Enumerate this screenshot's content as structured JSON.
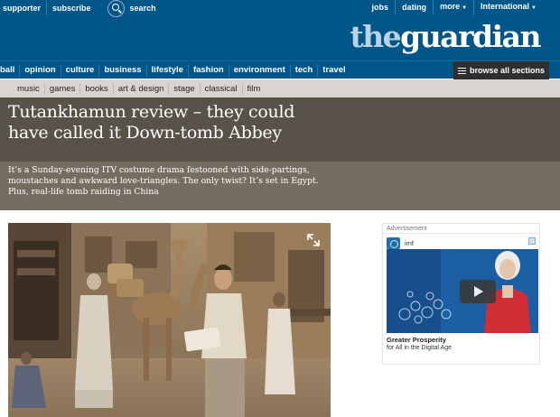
{
  "topbar": {
    "left_links": [
      "supporter",
      "subscribe"
    ],
    "search_label": "search",
    "right_links": [
      "jobs",
      "dating",
      "more",
      "International"
    ]
  },
  "logo": {
    "part1": "the",
    "part2": "guardian"
  },
  "section_nav": {
    "items": [
      "ball",
      "opinion",
      "culture",
      "business",
      "lifestyle",
      "fashion",
      "environment",
      "tech",
      "travel"
    ],
    "browse_label": "browse all sections"
  },
  "sub_nav": {
    "items": [
      "music",
      "games",
      "books",
      "art & design",
      "stage",
      "classical",
      "film"
    ]
  },
  "article": {
    "headline": "Tutankhamun review – they could have called it Down-tomb Abbey",
    "standfirst": "It’s a Sunday-evening ITV costume drama festooned with side-partings, moustaches and awkward love-triangles. The only twist? It’s set in Egypt. Plus, real-life tomb raiding in China"
  },
  "advert": {
    "label": "Advertisement",
    "brand": "imf",
    "title": "Greater Prosperity",
    "subtitle": "for All in the Digital Age"
  },
  "icons": {
    "search": "search-icon",
    "expand": "expand-icon",
    "menu": "hamburger-icon",
    "play": "play-icon"
  },
  "colors": {
    "brand_blue": "#005689",
    "browse_bg": "#2f2f2f",
    "headline_bg": "#585249",
    "standfirst_bg": "#766d61",
    "subnav_bg": "#d8d5d0"
  }
}
